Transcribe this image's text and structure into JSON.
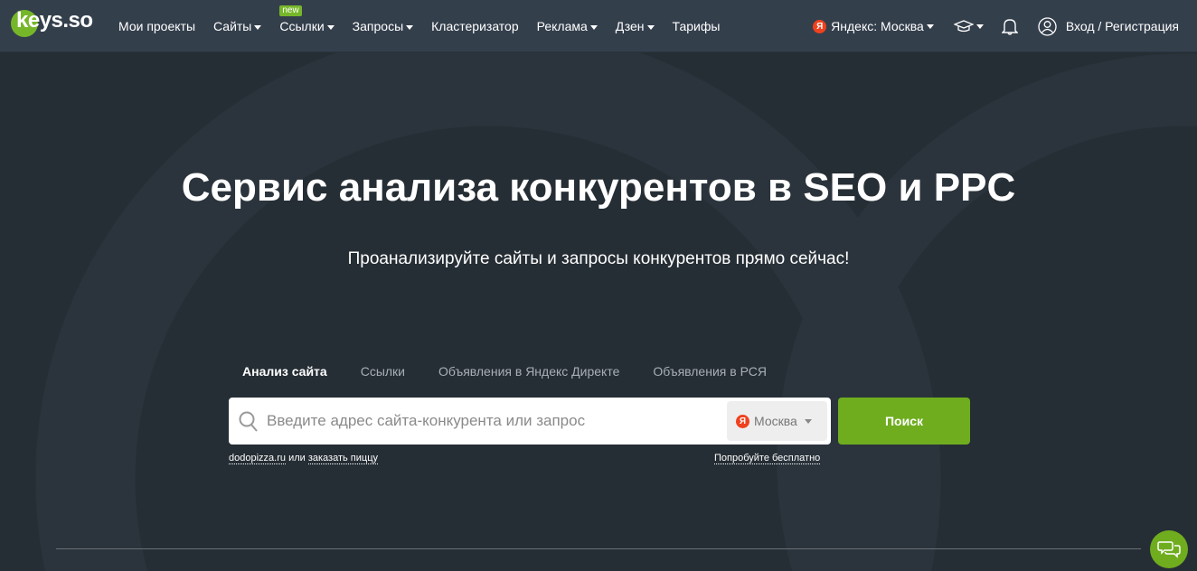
{
  "header": {
    "logo": "keys.so",
    "nav": [
      {
        "label": "Мои проекты"
      },
      {
        "label": "Сайты",
        "dropdown": true
      },
      {
        "label": "Ссылки",
        "dropdown": true,
        "badge": "new"
      },
      {
        "label": "Запросы",
        "dropdown": true
      },
      {
        "label": "Кластеризатор"
      },
      {
        "label": "Реклама",
        "dropdown": true
      },
      {
        "label": "Дзен",
        "dropdown": true
      },
      {
        "label": "Тарифы"
      }
    ],
    "region": "Яндекс: Москва",
    "yandex_glyph": "Я",
    "login": "Вход / Регистрация"
  },
  "hero": {
    "title": "Сервис анализа конкурентов в SEO и PPC",
    "subtitle": "Проанализируйте сайты и запросы конкурентов прямо сейчас!"
  },
  "tabs": [
    "Анализ сайта",
    "Ссылки",
    "Объявления в Яндекс Директе",
    "Объявления в РСЯ"
  ],
  "search": {
    "placeholder": "Введите адрес сайта-конкурента или запрос",
    "region": "Москва",
    "button": "Поиск"
  },
  "hints": {
    "example1": "dodopizza.ru",
    "or": "или",
    "example2": "заказать пиццу",
    "try_free": "Попробуйте бесплатно"
  },
  "colors": {
    "accent": "#6fad1f",
    "header": "#343f4c",
    "background": "#262e35"
  }
}
